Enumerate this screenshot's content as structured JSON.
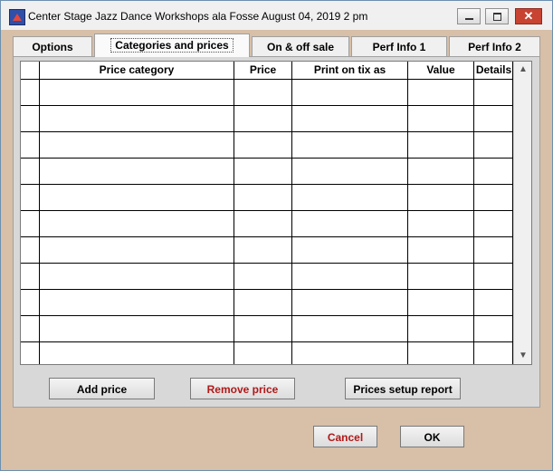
{
  "window": {
    "title": "Center Stage Jazz Dance Workshops ala Fosse August 04, 2019 2 pm",
    "close_glyph": "✕"
  },
  "tabs": [
    {
      "label": "Options",
      "active": false
    },
    {
      "label": "Categories and prices",
      "active": true
    },
    {
      "label": "On & off sale",
      "active": false
    },
    {
      "label": "Perf Info 1",
      "active": false
    },
    {
      "label": "Perf Info 2",
      "active": false
    }
  ],
  "grid": {
    "columns": [
      "",
      "Price category",
      "Price",
      "Print on tix as",
      "Value",
      "Details"
    ],
    "empty_rows": 11,
    "scroll_up_glyph": "▲",
    "scroll_down_glyph": "▼"
  },
  "buttons": {
    "add_price": "Add price",
    "remove_price": "Remove price",
    "prices_report": "Prices setup report",
    "cancel": "Cancel",
    "ok": "OK"
  },
  "colors": {
    "background": "#d7bfa8",
    "danger_text": "#b01818"
  }
}
